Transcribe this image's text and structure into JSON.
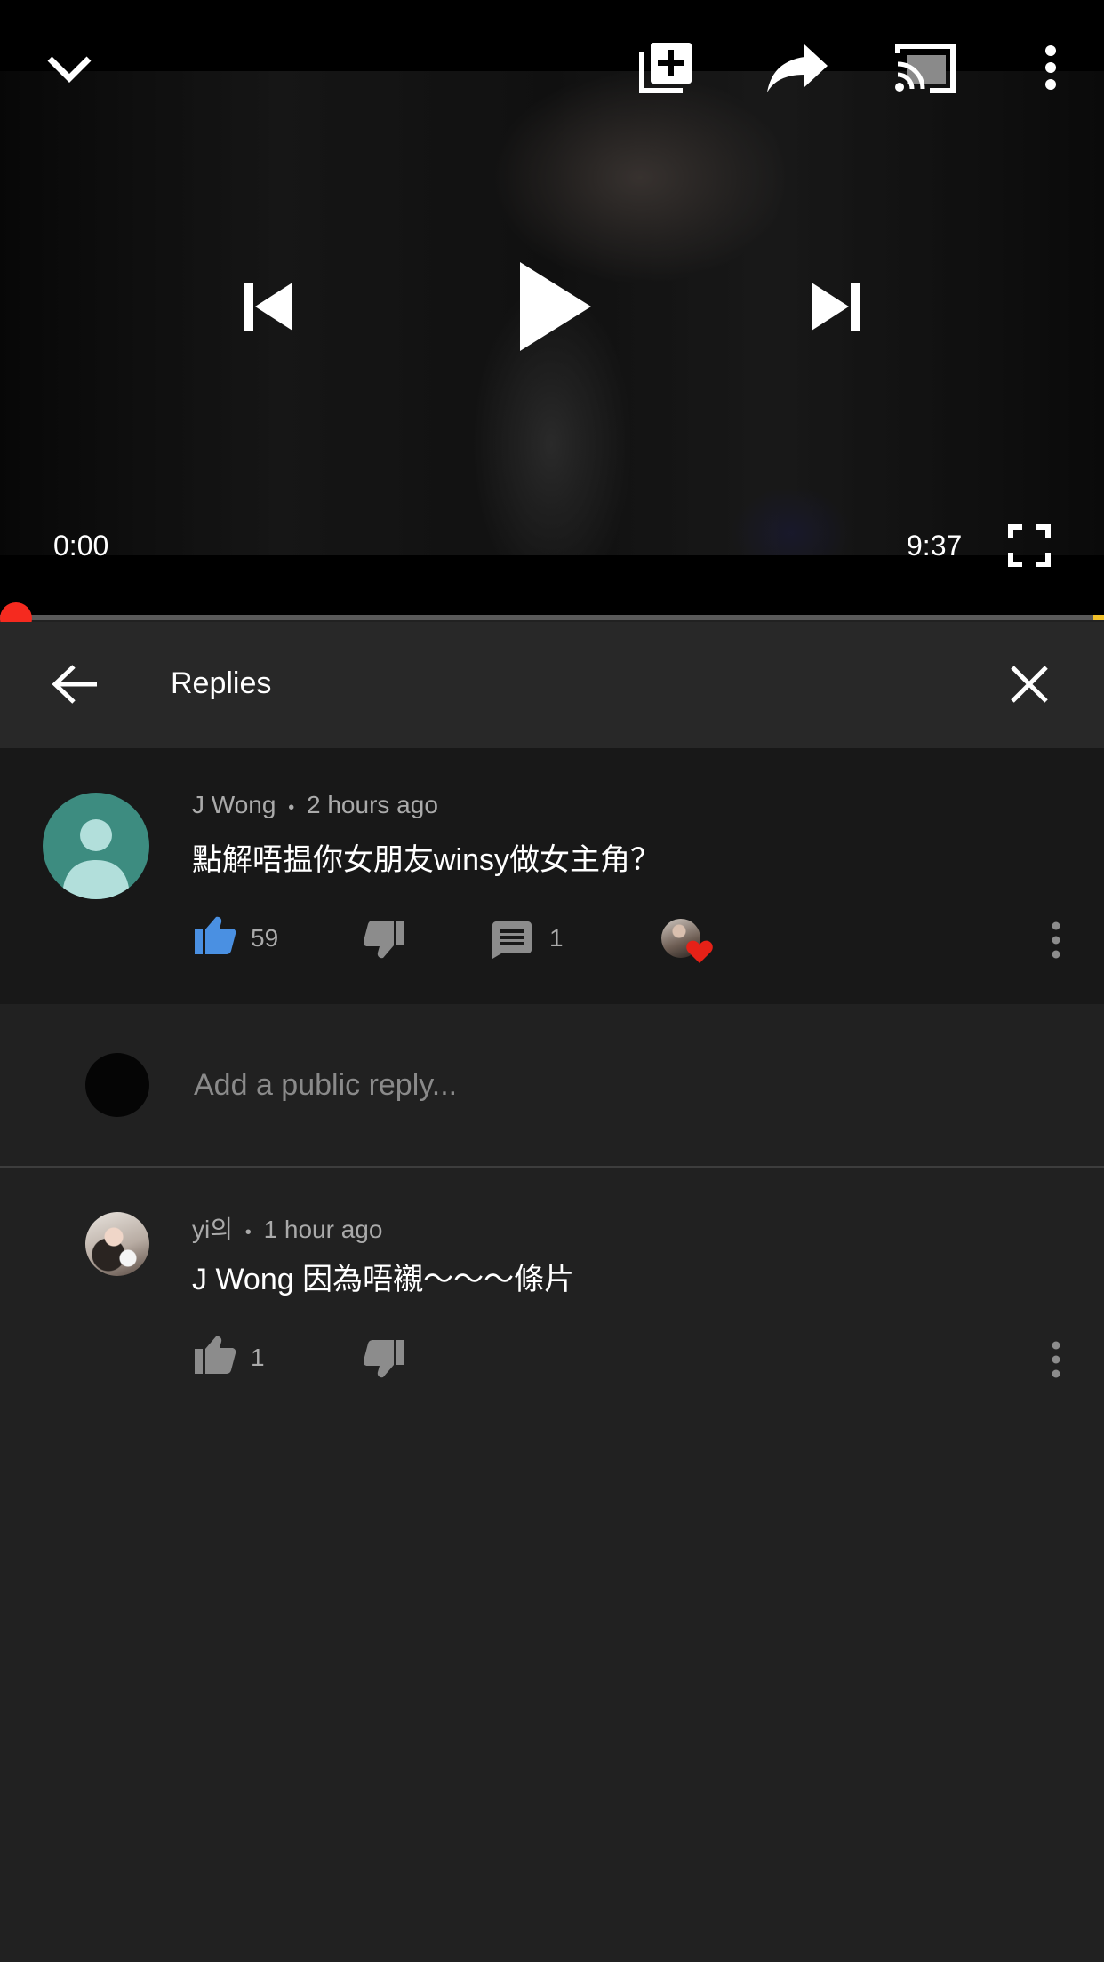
{
  "player": {
    "current_time": "0:00",
    "duration": "9:37",
    "progress_fraction": 0.0
  },
  "replies_panel": {
    "title": "Replies"
  },
  "parent_comment": {
    "author": "J Wong",
    "separator": "•",
    "time": "2 hours ago",
    "text": "點解唔揾你女朋友winsy做女主角？",
    "likes": "59",
    "replies": "1",
    "hearted_by_creator": true
  },
  "reply_box": {
    "placeholder": "Add a public reply..."
  },
  "reply": {
    "author": "yi의",
    "separator": "•",
    "time": "1 hour ago",
    "text": "J Wong 因為唔襯～～～條片",
    "likes": "1"
  },
  "colors": {
    "background": "#212121",
    "accent_like": "#4a90e2",
    "progress": "#ff0000",
    "heart": "#e62117"
  },
  "icons": [
    "minimize-icon",
    "add-to-playlist-icon",
    "share-icon",
    "cast-icon",
    "more-vert-icon",
    "previous-icon",
    "play-icon",
    "next-icon",
    "fullscreen-icon",
    "back-arrow-icon",
    "close-icon",
    "thumb-up-icon",
    "thumb-down-icon",
    "comment-icon",
    "heart-icon"
  ]
}
